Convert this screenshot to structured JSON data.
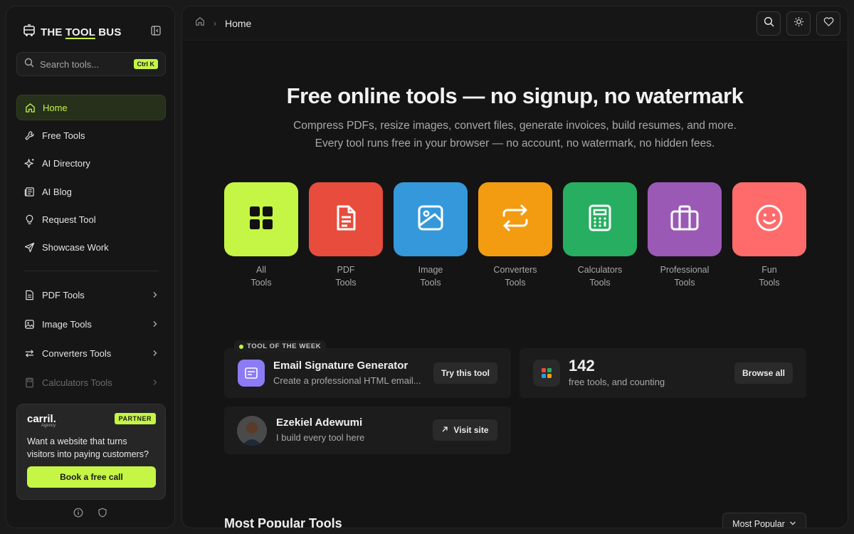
{
  "brand": {
    "pre": "THE ",
    "highlight": "TOOL",
    "post": " BUS"
  },
  "search": {
    "placeholder": "Search tools...",
    "shortcut": "Ctrl K"
  },
  "nav": [
    {
      "label": "Home",
      "icon": "home-icon",
      "active": true
    },
    {
      "label": "Free Tools",
      "icon": "wrench-icon"
    },
    {
      "label": "AI Directory",
      "icon": "sparkle-icon"
    },
    {
      "label": "AI Blog",
      "icon": "newspaper-icon"
    },
    {
      "label": "Request Tool",
      "icon": "lightbulb-icon"
    },
    {
      "label": "Showcase Work",
      "icon": "send-icon"
    }
  ],
  "categories": [
    {
      "label": "PDF Tools",
      "icon": "file-icon"
    },
    {
      "label": "Image Tools",
      "icon": "image-icon"
    },
    {
      "label": "Converters Tools",
      "icon": "swap-icon"
    },
    {
      "label": "Calculators Tools",
      "icon": "calculator-icon"
    }
  ],
  "partner": {
    "logo": "carril.",
    "logo_sub": "Agency",
    "badge": "PARTNER",
    "pitch": "Want a website that turns visitors into paying customers?",
    "cta": "Book a free call"
  },
  "breadcrumb": {
    "current": "Home"
  },
  "hero": {
    "title": "Free online tools — no signup, no watermark",
    "line1": "Compress PDFs, resize images, convert files, generate invoices, build resumes, and more.",
    "line2": "Every tool runs free in your browser — no account, no watermark, no hidden fees."
  },
  "tiles": [
    {
      "l1": "All",
      "l2": "Tools",
      "color": "#c5f545",
      "icon": "grid-icon"
    },
    {
      "l1": "PDF",
      "l2": "Tools",
      "color": "#e74c3c",
      "icon": "file-icon"
    },
    {
      "l1": "Image",
      "l2": "Tools",
      "color": "#3498db",
      "icon": "image-icon"
    },
    {
      "l1": "Converters",
      "l2": "Tools",
      "color": "#f39c12",
      "icon": "swap-icon"
    },
    {
      "l1": "Calculators",
      "l2": "Tools",
      "color": "#27ae60",
      "icon": "calculator-icon"
    },
    {
      "l1": "Professional",
      "l2": "Tools",
      "color": "#9b59b6",
      "icon": "briefcase-icon"
    },
    {
      "l1": "Fun",
      "l2": "Tools",
      "color": "#ff6b6b",
      "icon": "smile-icon"
    }
  ],
  "tool_of_week": {
    "tag": "TOOL OF THE WEEK",
    "title": "Email Signature Generator",
    "desc": "Create a professional HTML email...",
    "cta": "Try this tool"
  },
  "counter": {
    "count": "142",
    "label": "free tools, and counting",
    "cta": "Browse all"
  },
  "author": {
    "name": "Ezekiel Adewumi",
    "desc": "I build every tool here",
    "cta": "Visit site"
  },
  "popular": {
    "title": "Most Popular Tools",
    "sort": "Most Popular"
  }
}
